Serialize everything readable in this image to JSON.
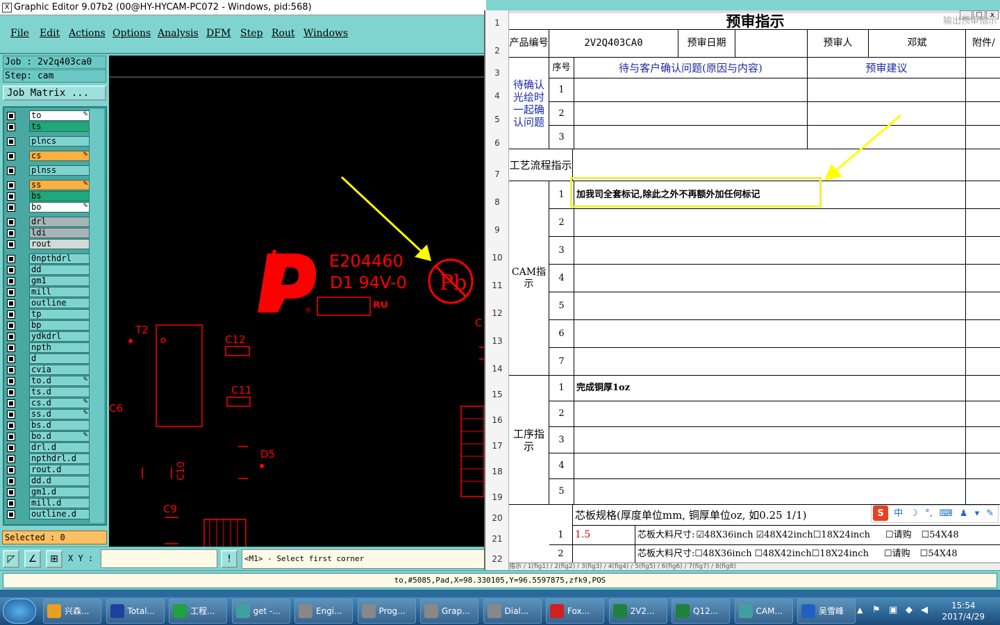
{
  "window": {
    "title": "Graphic Editor 9.07b2 (00@HY-HYCAM-PC072 - Windows, pid:568)"
  },
  "menu": [
    "File",
    "Edit",
    "Actions",
    "Options",
    "Analysis",
    "DFM",
    "Step",
    "Rout",
    "Windows"
  ],
  "job": {
    "job_line": "Job : 2v2q403ca0",
    "step_line": "Step: cam",
    "matrix_label": "Job Matrix ..."
  },
  "layers": [
    {
      "name": "to",
      "color": "#ffffff",
      "pen": true
    },
    {
      "name": "ts",
      "color": "#20a878",
      "pen": false
    },
    {
      "name": "plncs",
      "color": "#7fd4d0",
      "pen": false
    },
    {
      "name": "cs",
      "color": "#fcb040",
      "pen": true
    },
    {
      "name": "plnss",
      "color": "#7fd4d0",
      "pen": false
    },
    {
      "name": "ss",
      "color": "#fcb040",
      "pen": true
    },
    {
      "name": "bs",
      "color": "#20a878",
      "pen": false
    },
    {
      "name": "bo",
      "color": "#ffffff",
      "pen": true
    },
    {
      "name": "drl",
      "color": "#a8b4b8",
      "pen": false
    },
    {
      "name": "ldi",
      "color": "#a8b4b8",
      "pen": false
    },
    {
      "name": "rout",
      "color": "#d4d8d8",
      "pen": false
    },
    {
      "name": "0npthdrl",
      "color": "#7fd4d0",
      "pen": false
    },
    {
      "name": "dd",
      "color": "#7fd4d0",
      "pen": false
    },
    {
      "name": "gm1",
      "color": "#7fd4d0",
      "pen": false
    },
    {
      "name": "mill",
      "color": "#7fd4d0",
      "pen": false
    },
    {
      "name": "outline",
      "color": "#7fd4d0",
      "pen": false
    },
    {
      "name": "tp",
      "color": "#7fd4d0",
      "pen": false
    },
    {
      "name": "bp",
      "color": "#7fd4d0",
      "pen": false
    },
    {
      "name": "ydkdrl",
      "color": "#7fd4d0",
      "pen": false
    },
    {
      "name": "npth",
      "color": "#7fd4d0",
      "pen": false
    },
    {
      "name": "d",
      "color": "#7fd4d0",
      "pen": false
    },
    {
      "name": "cvia",
      "color": "#7fd4d0",
      "pen": false
    },
    {
      "name": "to.d",
      "color": "#7fd4d0",
      "pen": true
    },
    {
      "name": "ts.d",
      "color": "#7fd4d0",
      "pen": false
    },
    {
      "name": "cs.d",
      "color": "#7fd4d0",
      "pen": true
    },
    {
      "name": "ss.d",
      "color": "#7fd4d0",
      "pen": true
    },
    {
      "name": "bs.d",
      "color": "#7fd4d0",
      "pen": false
    },
    {
      "name": "bo.d",
      "color": "#7fd4d0",
      "pen": true
    },
    {
      "name": "drl.d",
      "color": "#7fd4d0",
      "pen": false
    },
    {
      "name": "npthdrl.d",
      "color": "#7fd4d0",
      "pen": false
    },
    {
      "name": "rout.d",
      "color": "#7fd4d0",
      "pen": false
    },
    {
      "name": "dd.d",
      "color": "#7fd4d0",
      "pen": false
    },
    {
      "name": "gm1.d",
      "color": "#7fd4d0",
      "pen": false
    },
    {
      "name": "mill.d",
      "color": "#7fd4d0",
      "pen": false
    },
    {
      "name": "outline.d",
      "color": "#7fd4d0",
      "pen": false
    }
  ],
  "selected": "Selected : 0",
  "canvas": {
    "ul_number": "E204460",
    "ul_rating": "D1  94V-0",
    "pb_symbol": "Pb",
    "labels": [
      "T2",
      "C12",
      "C11",
      "C6",
      "D5",
      "C10",
      "C9",
      "C"
    ],
    "trace_color": "#ff0000",
    "arrow_color": "#ffff00"
  },
  "bottom": {
    "xy_label": "X Y :",
    "xy_value": "",
    "prompt": "<M1> - Select first corner"
  },
  "status": "to,#5085,Pad,X=98.330105,Y=96.5597875,zfk9,POS",
  "excel": {
    "hint": "输出预审指示",
    "title": "预审指示",
    "rows": [
      "1",
      "2",
      "3",
      "4",
      "5",
      "6",
      "7",
      "8",
      "9",
      "10",
      "11",
      "12",
      "13",
      "14",
      "15",
      "16",
      "17",
      "18",
      "19",
      "20",
      "21",
      "22"
    ],
    "product_no_label": "产品编号",
    "product_no": "2V2Q403CA0",
    "review_date_label": "预审日期",
    "reviewer_label": "预审人",
    "reviewer": "邓斌",
    "attachment_label": "附件/",
    "seq_label": "序号",
    "issue_header": "待与客户确认问题(原因与内容)",
    "suggestion_header": "预审建议",
    "confirm_section": "待确认光绘时一起确认问题",
    "confirm_seq": [
      "1",
      "2",
      "3"
    ],
    "process_label": "工艺流程指示",
    "cam_label": "CAM指示",
    "cam_seq": [
      "1",
      "2",
      "3",
      "4",
      "5",
      "6",
      "7"
    ],
    "cam_item1": "加我司全套标记,除此之外不再额外加任何标记",
    "proc_label": "工序指示",
    "proc_seq": [
      "1",
      "2",
      "3",
      "4",
      "5"
    ],
    "proc_item1": "完成铜厚1oz",
    "core_spec": "芯板规格(厚度单位mm, 铜厚单位oz, 如0.25 1/1)",
    "core_row1_seq": "1",
    "core_row1_thk": "1.5",
    "core_row2_seq": "2",
    "core_size_label": "芯板大料尺寸:",
    "core_sizes": [
      "48X36inch",
      "48X42inch",
      "18X24inch",
      "请购",
      "54X48"
    ],
    "sheet_tabs": "指示 / 1(fig1) / 2(fig2) / 3(fig3) / 4(fig4) / 5(fig5) / 6(fig6) / 7(fig7) / 8(fig8)"
  },
  "ime": {
    "text": "中"
  },
  "taskbar": {
    "tasks": [
      {
        "label": "兴森...",
        "color": "#e8a020"
      },
      {
        "label": "Total...",
        "color": "#2040a0"
      },
      {
        "label": "工程...",
        "color": "#20a040"
      },
      {
        "label": "get -...",
        "color": "#40a0a0"
      },
      {
        "label": "Engi...",
        "color": "#888888"
      },
      {
        "label": "Prog...",
        "color": "#888888"
      },
      {
        "label": "Grap...",
        "color": "#888888"
      },
      {
        "label": "Dial...",
        "color": "#888888"
      },
      {
        "label": "Fox...",
        "color": "#d02020"
      },
      {
        "label": "2V2...",
        "color": "#208040"
      },
      {
        "label": "Q12...",
        "color": "#208040"
      },
      {
        "label": "CAM...",
        "color": "#40a0a0"
      },
      {
        "label": "吴雪峰",
        "color": "#2060c0"
      }
    ],
    "time": "15:54",
    "date": "2017/4/29"
  }
}
